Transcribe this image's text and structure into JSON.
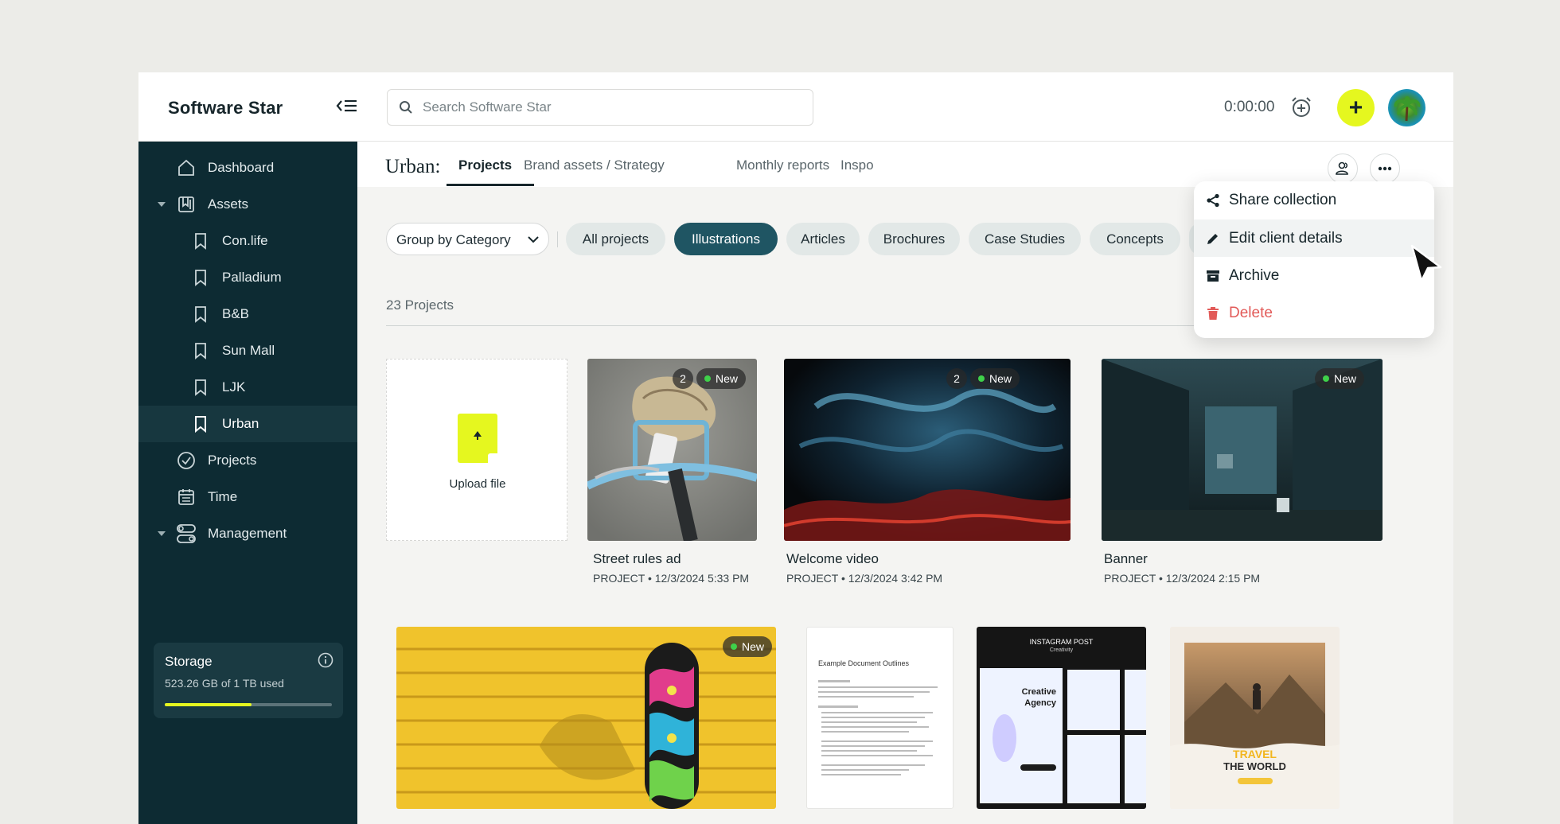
{
  "app": {
    "brand": "Software Star"
  },
  "topbar": {
    "search_placeholder": "Search Software Star",
    "timer": "0:00:00",
    "add_label": "+"
  },
  "sidebar": {
    "items": [
      {
        "label": "Dashboard",
        "icon": "home-icon"
      },
      {
        "label": "Assets",
        "icon": "assets-icon"
      },
      {
        "label": "Con.life",
        "icon": "bookmark-icon"
      },
      {
        "label": "Palladium",
        "icon": "bookmark-icon"
      },
      {
        "label": "B&B",
        "icon": "bookmark-icon"
      },
      {
        "label": "Sun Mall",
        "icon": "bookmark-icon"
      },
      {
        "label": "LJK",
        "icon": "bookmark-icon"
      },
      {
        "label": "Urban",
        "icon": "bookmark-icon"
      },
      {
        "label": "Projects",
        "icon": "check-circle-icon"
      },
      {
        "label": "Time",
        "icon": "calendar-icon"
      },
      {
        "label": "Management",
        "icon": "toggles-icon"
      }
    ],
    "storage": {
      "title": "Storage",
      "usage": "523.26 GB of 1 TB used",
      "fraction": 0.52
    }
  },
  "header": {
    "client": "Urban:",
    "tabs": [
      "Projects",
      "Brand assets / Strategy",
      "Monthly reports",
      "Inspo"
    ]
  },
  "filters": {
    "group_by": "Group by Category",
    "chips": [
      "All projects",
      "Illustrations",
      "Articles",
      "Brochures",
      "Case Studies",
      "Concepts"
    ]
  },
  "count": "23 Projects",
  "upload": {
    "label": "Upload file"
  },
  "cards": [
    {
      "title": "Street rules ad",
      "meta": "PROJECT • 12/3/2024 5:33 PM",
      "count": "2",
      "badge": "New"
    },
    {
      "title": "Welcome video",
      "meta": "PROJECT • 12/3/2024 3:42 PM",
      "count": "2",
      "badge": "New"
    },
    {
      "title": "Banner",
      "meta": "PROJECT • 12/3/2024 2:15 PM",
      "badge": "New"
    },
    {
      "badge": "New"
    }
  ],
  "thumbs": {
    "doc_title": "Example Document Outlines",
    "ig_header": "INSTAGRAM POST",
    "ig_sub": "Creativity",
    "ig_headline_1": "Creative",
    "ig_headline_2": "Agency",
    "travel_1": "TRAVEL",
    "travel_2": "THE WORLD"
  },
  "menu": {
    "items": [
      {
        "label": "Share collection",
        "icon": "share-icon"
      },
      {
        "label": "Edit client details",
        "icon": "pencil-icon"
      },
      {
        "label": "Archive",
        "icon": "archive-icon"
      },
      {
        "label": "Delete",
        "icon": "trash-icon"
      }
    ],
    "danger_color": "#e25a58"
  },
  "colors": {
    "sidebar": "#0d2b33",
    "accent": "#e5f71f",
    "chip_active": "#1f5563"
  }
}
